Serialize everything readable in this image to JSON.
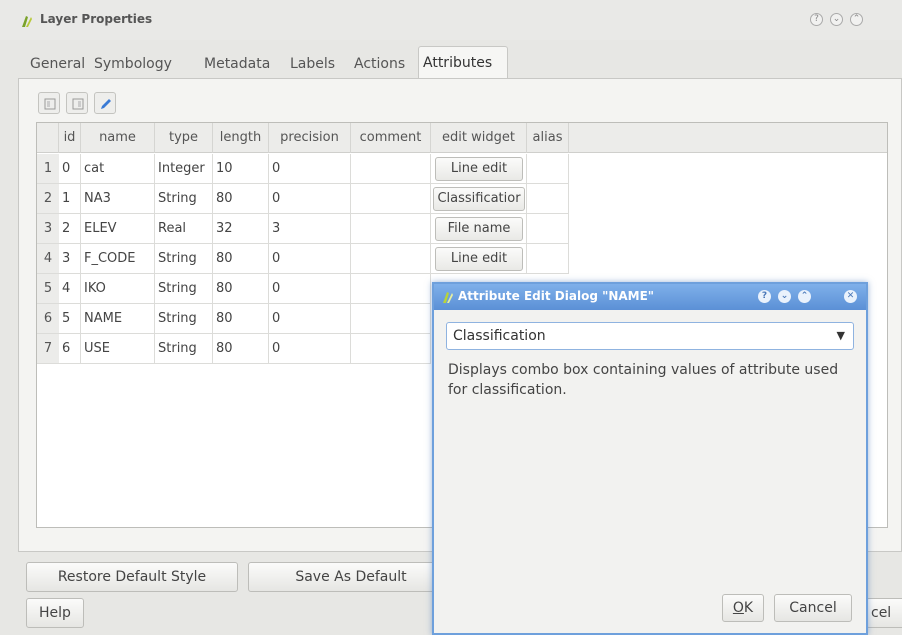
{
  "window": {
    "title": "Layer Properties",
    "controls": [
      "?",
      "⌄",
      "⌃"
    ]
  },
  "tabs": [
    {
      "label": "General"
    },
    {
      "label": "Symbology"
    },
    {
      "label": "Metadata"
    },
    {
      "label": "Labels"
    },
    {
      "label": "Actions"
    },
    {
      "label": "Attributes",
      "active": true
    }
  ],
  "toolbar": {
    "icons": [
      "new-column-icon",
      "delete-column-icon",
      "toggle-editing-icon"
    ]
  },
  "table": {
    "headers": [
      "id",
      "name",
      "type",
      "length",
      "precision",
      "comment",
      "edit widget",
      "alias"
    ],
    "rows": [
      {
        "num": "1",
        "id": "0",
        "name": "cat",
        "type": "Integer",
        "length": "10",
        "precision": "0",
        "comment": "",
        "widget": "Line edit",
        "alias": ""
      },
      {
        "num": "2",
        "id": "1",
        "name": "NA3",
        "type": "String",
        "length": "80",
        "precision": "0",
        "comment": "",
        "widget": "Classificatior",
        "alias": ""
      },
      {
        "num": "3",
        "id": "2",
        "name": "ELEV",
        "type": "Real",
        "length": "32",
        "precision": "3",
        "comment": "",
        "widget": "File name",
        "alias": ""
      },
      {
        "num": "4",
        "id": "3",
        "name": "F_CODE",
        "type": "String",
        "length": "80",
        "precision": "0",
        "comment": "",
        "widget": "Line edit",
        "alias": ""
      },
      {
        "num": "5",
        "id": "4",
        "name": "IKO",
        "type": "String",
        "length": "80",
        "precision": "0",
        "comment": "",
        "widget": "",
        "alias": ""
      },
      {
        "num": "6",
        "id": "5",
        "name": "NAME",
        "type": "String",
        "length": "80",
        "precision": "0",
        "comment": "",
        "widget": "",
        "alias": ""
      },
      {
        "num": "7",
        "id": "6",
        "name": "USE",
        "type": "String",
        "length": "80",
        "precision": "0",
        "comment": "",
        "widget": "",
        "alias": ""
      }
    ]
  },
  "buttons": {
    "restore": "Restore Default Style",
    "save_default": "Save As Default",
    "help": "Help",
    "cancel_partial": "cel"
  },
  "dialog": {
    "title": "Attribute Edit Dialog \"NAME\"",
    "selected_widget": "Classification",
    "description": "Displays combo box containing values of attribute used for classification.",
    "ok_key": "O",
    "ok_rest": "K",
    "cancel": "Cancel",
    "controls": [
      "?",
      "⌄",
      "⌃",
      "✕"
    ]
  },
  "colors": {
    "dialog_title": "#5b90d6",
    "app_icon": "#7aa22a"
  }
}
